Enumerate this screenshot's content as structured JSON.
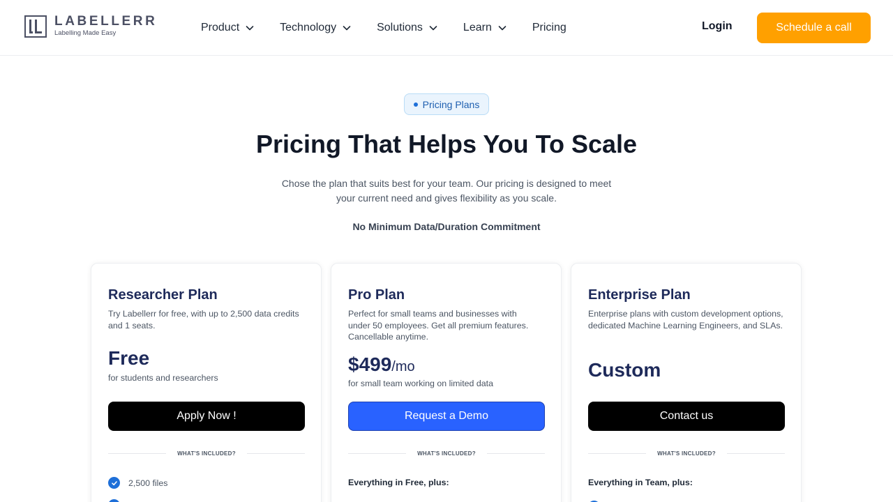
{
  "logo": {
    "name": "LABELLERR",
    "tagline": "Labelling Made Easy"
  },
  "nav": {
    "items": [
      {
        "label": "Product",
        "has_dropdown": true
      },
      {
        "label": "Technology",
        "has_dropdown": true
      },
      {
        "label": "Solutions",
        "has_dropdown": true
      },
      {
        "label": "Learn",
        "has_dropdown": true
      },
      {
        "label": "Pricing",
        "has_dropdown": false
      }
    ],
    "login": "Login",
    "cta": "Schedule a call"
  },
  "hero": {
    "badge": "Pricing Plans",
    "title": "Pricing That Helps You To Scale",
    "subtitle": "Chose the plan that suits best for your team. Our pricing is designed to meet your current need and gives flexibility as you scale.",
    "commitment": "No Minimum Data/Duration Commitment"
  },
  "plans": [
    {
      "name": "Researcher Plan",
      "description": "Try Labellerr for free, with up to 2,500 data credits and 1 seats.",
      "price": "Free",
      "price_suffix": "",
      "price_note": "for students and researchers",
      "button": "Apply Now !",
      "included_label": "WHAT'S INCLUDED?",
      "features": [
        "2,500 files"
      ]
    },
    {
      "name": "Pro Plan",
      "description": "Perfect for small teams and businesses with under 50 employees. Get all premium features. Cancellable anytime.",
      "price": "$499",
      "price_suffix": "/mo",
      "price_note": "for small team working on limited data",
      "button": "Request a Demo",
      "included_label": "WHAT'S INCLUDED?",
      "plus_heading": "Everything in Free, plus:"
    },
    {
      "name": "Enterprise Plan",
      "description": "Enterprise plans with custom development options, dedicated Machine Learning Engineers, and SLAs.",
      "price": "Custom",
      "price_suffix": "",
      "price_note": "",
      "button": "Contact us",
      "included_label": "WHAT'S INCLUDED?",
      "plus_heading": "Everything in Team, plus:"
    }
  ],
  "colors": {
    "accent_orange": "#ffa000",
    "primary_blue": "#2962ff",
    "navy": "#1e2a5a",
    "check_blue": "#1e6fd8"
  }
}
